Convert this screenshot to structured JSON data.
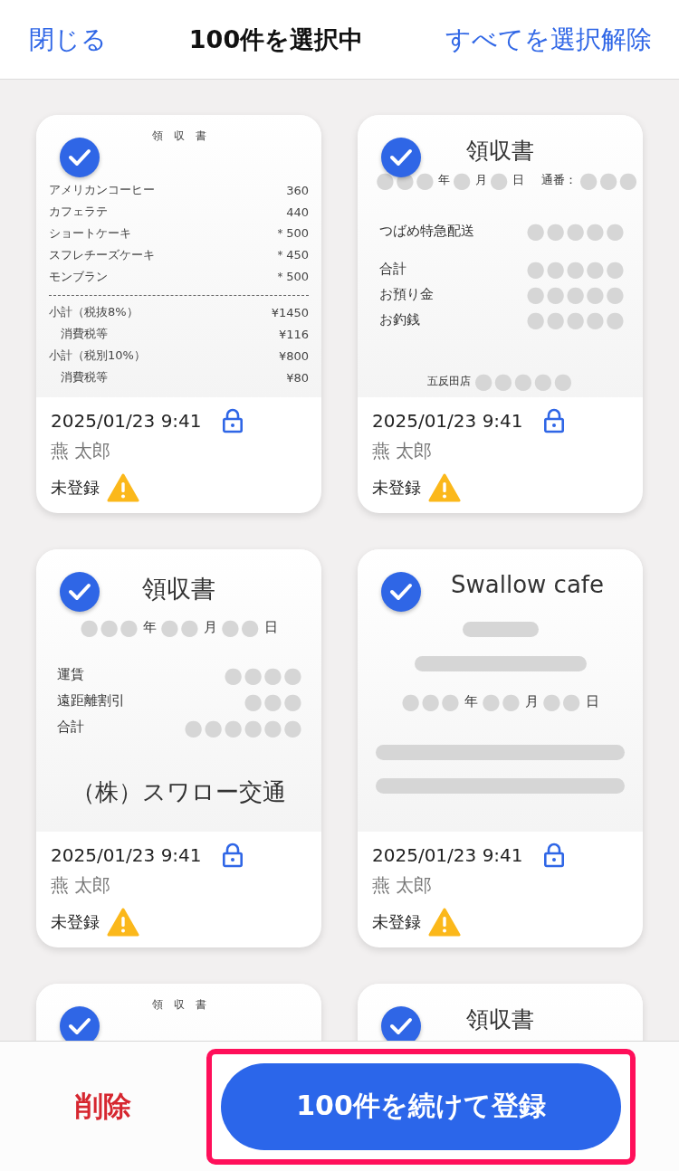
{
  "header": {
    "close": "閉じる",
    "title": "100件を選択中",
    "deselect_all": "すべてを選択解除"
  },
  "cards": [
    {
      "selected": true,
      "receipt": {
        "kind": "itemized",
        "lines": [
          {
            "kind": "title",
            "text": "領　収　書"
          },
          {
            "kind": "row",
            "label": "アメリカンコーヒー",
            "value": "360",
            "indent": false
          },
          {
            "kind": "row",
            "label": "カフェラテ",
            "value": "440",
            "indent": false
          },
          {
            "kind": "row",
            "label": "ショートケーキ",
            "value": "＊500",
            "indent": false
          },
          {
            "kind": "row",
            "label": "スフレチーズケーキ",
            "value": "＊450",
            "indent": false
          },
          {
            "kind": "row",
            "label": "モンブラン",
            "value": "＊500",
            "indent": false
          },
          {
            "kind": "rule"
          },
          {
            "kind": "row",
            "label": "小計（税抜8%）",
            "value": "¥1450",
            "indent": false
          },
          {
            "kind": "row",
            "label": "消費税等",
            "value": "¥116",
            "indent": true
          },
          {
            "kind": "row",
            "label": "小計（税別10%）",
            "value": "¥800",
            "indent": false
          },
          {
            "kind": "row",
            "label": "消費税等",
            "value": "¥80",
            "indent": true
          }
        ]
      },
      "datetime": "2025/01/23 9:41",
      "name": "燕 太郎",
      "status": "未登録"
    },
    {
      "selected": true,
      "receipt": {
        "kind": "masked",
        "lines": [
          {
            "kind": "title",
            "text": "領収書"
          },
          {
            "kind": "date",
            "parts": [
              {
                "text": "●●●",
                "masked": true
              },
              {
                "text": "年",
                "masked": false
              },
              {
                "text": "●",
                "masked": true
              },
              {
                "text": "月",
                "masked": false
              },
              {
                "text": "●",
                "masked": true
              },
              {
                "text": "日",
                "masked": false
              },
              {
                "text": "通番：",
                "masked": false
              },
              {
                "text": "●●●",
                "masked": true
              }
            ]
          },
          {
            "kind": "row",
            "label": "つばめ特急配送",
            "value": "●●●●●"
          },
          {
            "kind": "row",
            "label": "合計",
            "value": "●●●●●"
          },
          {
            "kind": "row",
            "label": "お預り金",
            "value": "●●●●●"
          },
          {
            "kind": "row",
            "label": "お釣銭",
            "value": "●●●●●"
          },
          {
            "kind": "footer",
            "parts": [
              {
                "text": "五反田店",
                "masked": false
              },
              {
                "text": "●●●●●",
                "masked": true
              }
            ]
          }
        ]
      },
      "datetime": "2025/01/23 9:41",
      "name": "燕 太郎",
      "status": "未登録"
    },
    {
      "selected": true,
      "receipt": {
        "kind": "fare",
        "lines": [
          {
            "kind": "title",
            "text": "領収書"
          },
          {
            "kind": "date",
            "parts": [
              {
                "text": "●●●",
                "masked": true
              },
              {
                "text": "年",
                "masked": false
              },
              {
                "text": "●●",
                "masked": true
              },
              {
                "text": "月",
                "masked": false
              },
              {
                "text": "●●",
                "masked": true
              },
              {
                "text": "日",
                "masked": false
              }
            ]
          },
          {
            "kind": "row",
            "label": "運賃",
            "value": "●●●●"
          },
          {
            "kind": "row",
            "label": "遠距離割引",
            "value": "●●●"
          },
          {
            "kind": "row",
            "label": "合計",
            "value": "●●●●●●"
          },
          {
            "kind": "company",
            "text": "（株）スワロー交通"
          }
        ]
      },
      "datetime": "2025/01/23 9:41",
      "name": "燕 太郎",
      "status": "未登録"
    },
    {
      "selected": true,
      "receipt": {
        "kind": "cafe",
        "lines": [
          {
            "kind": "title",
            "text": "Swallow cafe"
          },
          {
            "kind": "short_bar"
          },
          {
            "kind": "medium_bar"
          },
          {
            "kind": "date",
            "parts": [
              {
                "text": "●●●",
                "masked": true
              },
              {
                "text": "年",
                "masked": false
              },
              {
                "text": "●●",
                "masked": true
              },
              {
                "text": "月",
                "masked": false
              },
              {
                "text": "●●",
                "masked": true
              },
              {
                "text": "日",
                "masked": false
              }
            ]
          },
          {
            "kind": "long_bar"
          },
          {
            "kind": "long_bar"
          }
        ]
      },
      "datetime": "2025/01/23 9:41",
      "name": "燕 太郎",
      "status": "未登録"
    },
    {
      "selected": true,
      "receipt": {
        "kind": "itemized",
        "lines": [
          {
            "kind": "title",
            "text": "領　収　書"
          }
        ]
      }
    },
    {
      "selected": true,
      "receipt": {
        "kind": "masked",
        "lines": [
          {
            "kind": "title",
            "text": "領収書"
          }
        ]
      }
    }
  ],
  "footer": {
    "delete": "削除",
    "register": "100件を続けて登録"
  }
}
